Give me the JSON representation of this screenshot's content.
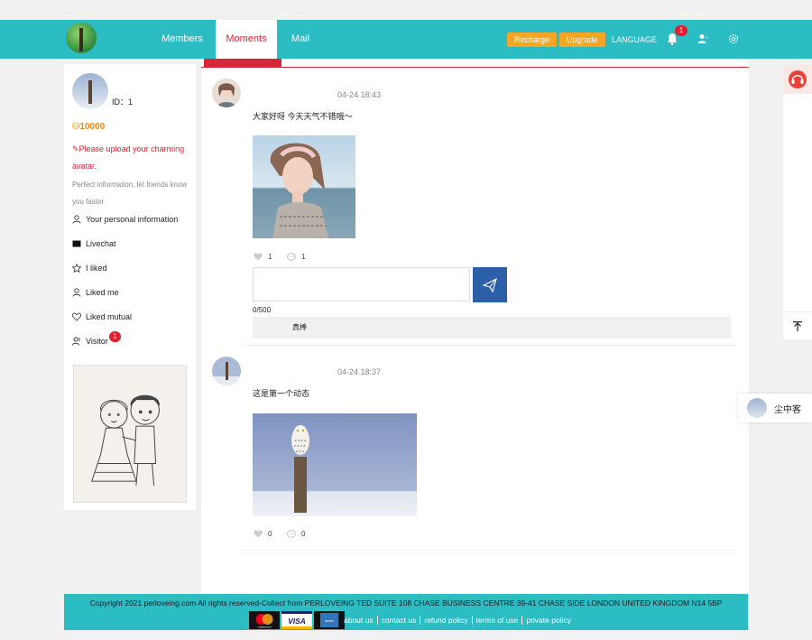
{
  "header": {
    "nav": [
      {
        "label": "Members"
      },
      {
        "label": "Moments"
      },
      {
        "label": "Mail"
      }
    ],
    "recharge_label": "Recharge",
    "upgrade_label": "Upgrade",
    "language_label": "LANGUAGE",
    "notification_count": "1",
    "accent": "#2bbcc4",
    "active_color": "#d9273a"
  },
  "profile": {
    "id_text": "ID：1",
    "coins": "10000",
    "upload_msg": "Please upload your charming avatar.",
    "perfect_msg": "Perfect information, let friends know you faster",
    "menu": [
      {
        "label": "Your personal information",
        "icon": "user-icon"
      },
      {
        "label": "Livechat",
        "icon": "chat-icon"
      },
      {
        "label": "I liked",
        "icon": "star-icon"
      },
      {
        "label": "Liked me",
        "icon": "user-icon"
      },
      {
        "label": "Liked mutual",
        "icon": "heart-icon"
      },
      {
        "label": "Visitor",
        "icon": "users-icon"
      }
    ],
    "visitor_count": "1"
  },
  "feed": {
    "posts": [
      {
        "time": "04-24 18:43",
        "text": "大家好呀 今天天气不错哦～",
        "likes": "1",
        "comments": "1",
        "char_count": "0/500",
        "reply": "真棒"
      },
      {
        "time": "04-24 18:37",
        "text": "这是第一个动态",
        "likes": "0",
        "comments": "0"
      }
    ]
  },
  "chat": {
    "contact_name": "尘中客"
  },
  "footer": {
    "copyright": "Copyright 2021 perloveing.com All rights reserved-Collect from PERLOVEING TED SUITE 108 CHASE BUSINESS CENTRE 39-41 CHASE SIDE LONDON UNITED KINGDOM N14 5BP",
    "cards": [
      "mastercard",
      "VISA",
      "amex"
    ],
    "links": [
      "about us",
      "contact us",
      "refund policy",
      "terms of use",
      "private policy"
    ]
  }
}
